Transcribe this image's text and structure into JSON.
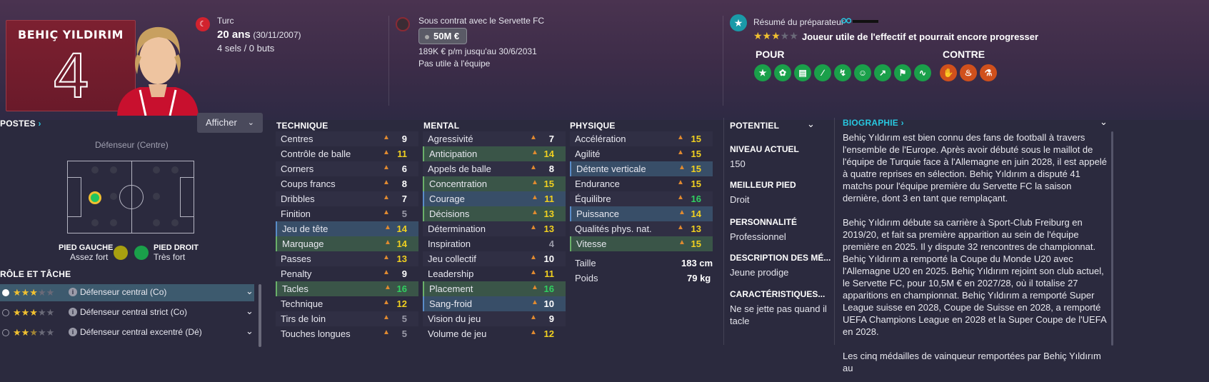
{
  "player": {
    "name": "BEHIÇ YILDIRIM",
    "number": "4",
    "nationality": "Turc",
    "age": "20 ans",
    "dob": "(30/11/2007)",
    "caps": "4 sels / 0 buts"
  },
  "contract": {
    "club": "Sous contrat avec le Servette FC",
    "value": "50M €",
    "wage": "189K € p/m jusqu'au 30/6/2031",
    "status": "Pas utile à l'équipe"
  },
  "coach_report": {
    "title": "Résumé du préparateur",
    "stars": 3,
    "max_stars": 5,
    "summary": "Joueur utile de l'effectif et pourrait encore progresser",
    "pour_label": "POUR",
    "contre_label": "CONTRE",
    "pour_icons": [
      "star-icon",
      "brain-icon",
      "tactic-board-icon",
      "bandage-icon",
      "dribble-icon",
      "happy-face-icon",
      "growth-chart-icon",
      "flag-icon",
      "wave-icon"
    ],
    "contre_icons": [
      "handshake-icon",
      "fire-icon",
      "flask-icon"
    ]
  },
  "positions": {
    "title": "POSTES",
    "afficher": "Afficher",
    "position_label": "Défenseur (Centre)",
    "foot_left_label": "PIED GAUCHE",
    "foot_left_value": "Assez fort",
    "foot_right_label": "PIED DROIT",
    "foot_right_value": "Très fort"
  },
  "roles": {
    "title": "RÔLE ET TÂCHE",
    "items": [
      {
        "label": "Défenseur central (Co)",
        "stars": 3,
        "selected": true
      },
      {
        "label": "Défenseur central strict (Co)",
        "stars": 3,
        "selected": false
      },
      {
        "label": "Défenseur central excentré (Dé)",
        "stars": 2.5,
        "selected": false
      }
    ]
  },
  "technique": {
    "title": "TECHNIQUE",
    "rows": [
      {
        "name": "Centres",
        "value": "9"
      },
      {
        "name": "Contrôle de balle",
        "value": "11"
      },
      {
        "name": "Corners",
        "value": "6"
      },
      {
        "name": "Coups francs",
        "value": "8"
      },
      {
        "name": "Dribbles",
        "value": "7"
      },
      {
        "name": "Finition",
        "value": "5"
      },
      {
        "name": "Jeu de tête",
        "value": "14"
      },
      {
        "name": "Marquage",
        "value": "14"
      },
      {
        "name": "Passes",
        "value": "13"
      },
      {
        "name": "Penalty",
        "value": "9"
      },
      {
        "name": "Tacles",
        "value": "16"
      },
      {
        "name": "Technique",
        "value": "12"
      },
      {
        "name": "Tirs de loin",
        "value": "5"
      },
      {
        "name": "Touches longues",
        "value": "5"
      }
    ]
  },
  "mental": {
    "title": "MENTAL",
    "rows": [
      {
        "name": "Agressivité",
        "value": "7"
      },
      {
        "name": "Anticipation",
        "value": "14"
      },
      {
        "name": "Appels de balle",
        "value": "8"
      },
      {
        "name": "Concentration",
        "value": "15"
      },
      {
        "name": "Courage",
        "value": "11"
      },
      {
        "name": "Décisions",
        "value": "13"
      },
      {
        "name": "Détermination",
        "value": "13"
      },
      {
        "name": "Inspiration",
        "value": "4"
      },
      {
        "name": "Jeu collectif",
        "value": "10"
      },
      {
        "name": "Leadership",
        "value": "11"
      },
      {
        "name": "Placement",
        "value": "16"
      },
      {
        "name": "Sang-froid",
        "value": "10"
      },
      {
        "name": "Vision du jeu",
        "value": "9"
      },
      {
        "name": "Volume de jeu",
        "value": "12"
      }
    ]
  },
  "physique": {
    "title": "PHYSIQUE",
    "rows": [
      {
        "name": "Accélération",
        "value": "15"
      },
      {
        "name": "Agilité",
        "value": "15"
      },
      {
        "name": "Détente verticale",
        "value": "15"
      },
      {
        "name": "Endurance",
        "value": "15"
      },
      {
        "name": "Équilibre",
        "value": "16"
      },
      {
        "name": "Puissance",
        "value": "14"
      },
      {
        "name": "Qualités phys. nat.",
        "value": "13"
      },
      {
        "name": "Vitesse",
        "value": "15"
      }
    ],
    "height_label": "Taille",
    "height_value": "183 cm",
    "weight_label": "Poids",
    "weight_value": "79 kg"
  },
  "side": {
    "potentiel": "POTENTIEL",
    "niveau_label": "NIVEAU ACTUEL",
    "niveau_value": "150",
    "pied_label": "MEILLEUR PIED",
    "pied_value": "Droit",
    "perso_label": "PERSONNALITÉ",
    "perso_value": "Professionnel",
    "desc_label": "DESCRIPTION DES MÉ...",
    "desc_value": "Jeune prodige",
    "carac_label": "CARACTÉRISTIQUES...",
    "carac_value_1": "Ne se jette pas quand il",
    "carac_value_2": "tacle"
  },
  "biography": {
    "title": "BIOGRAPHIE",
    "p1": "Behiç Yıldırım est bien connu des fans de football à travers l'ensemble de l'Europe. Après avoir débuté sous le maillot de l'équipe de Turquie face à l'Allemagne en juin 2028, il est appelé à quatre reprises en sélection. Behiç Yıldırım a disputé 41 matchs pour l'équipe première du Servette FC la saison dernière, dont 3 en tant que remplaçant.",
    "p2": "Behiç Yıldırım débute sa carrière à Sport-Club Freiburg en 2019/20, et fait sa première apparition au sein de l'équipe première en 2025. Il y dispute 32 rencontres de championnat. Behiç Yıldırım a remporté la Coupe du Monde U20 avec l'Allemagne U20 en 2025. Behiç Yıldırım rejoint son club actuel, le Servette FC, pour 10,5M € en 2027/28, où il totalise 27 apparitions en championnat. Behiç Yıldırım a remporté Super League suisse en 2028, Coupe de Suisse en 2028, a remporté UEFA Champions League en 2028 et la Super Coupe de l'UEFA en 2028.",
    "p3": "Les cinq médailles de vainqueur remportées par Behiç Yıldırım au"
  },
  "colors": {
    "accent": "#28c8e0",
    "yellow_value": "#f0d020",
    "green_value": "#30d060",
    "card_red": "#7c2030"
  }
}
